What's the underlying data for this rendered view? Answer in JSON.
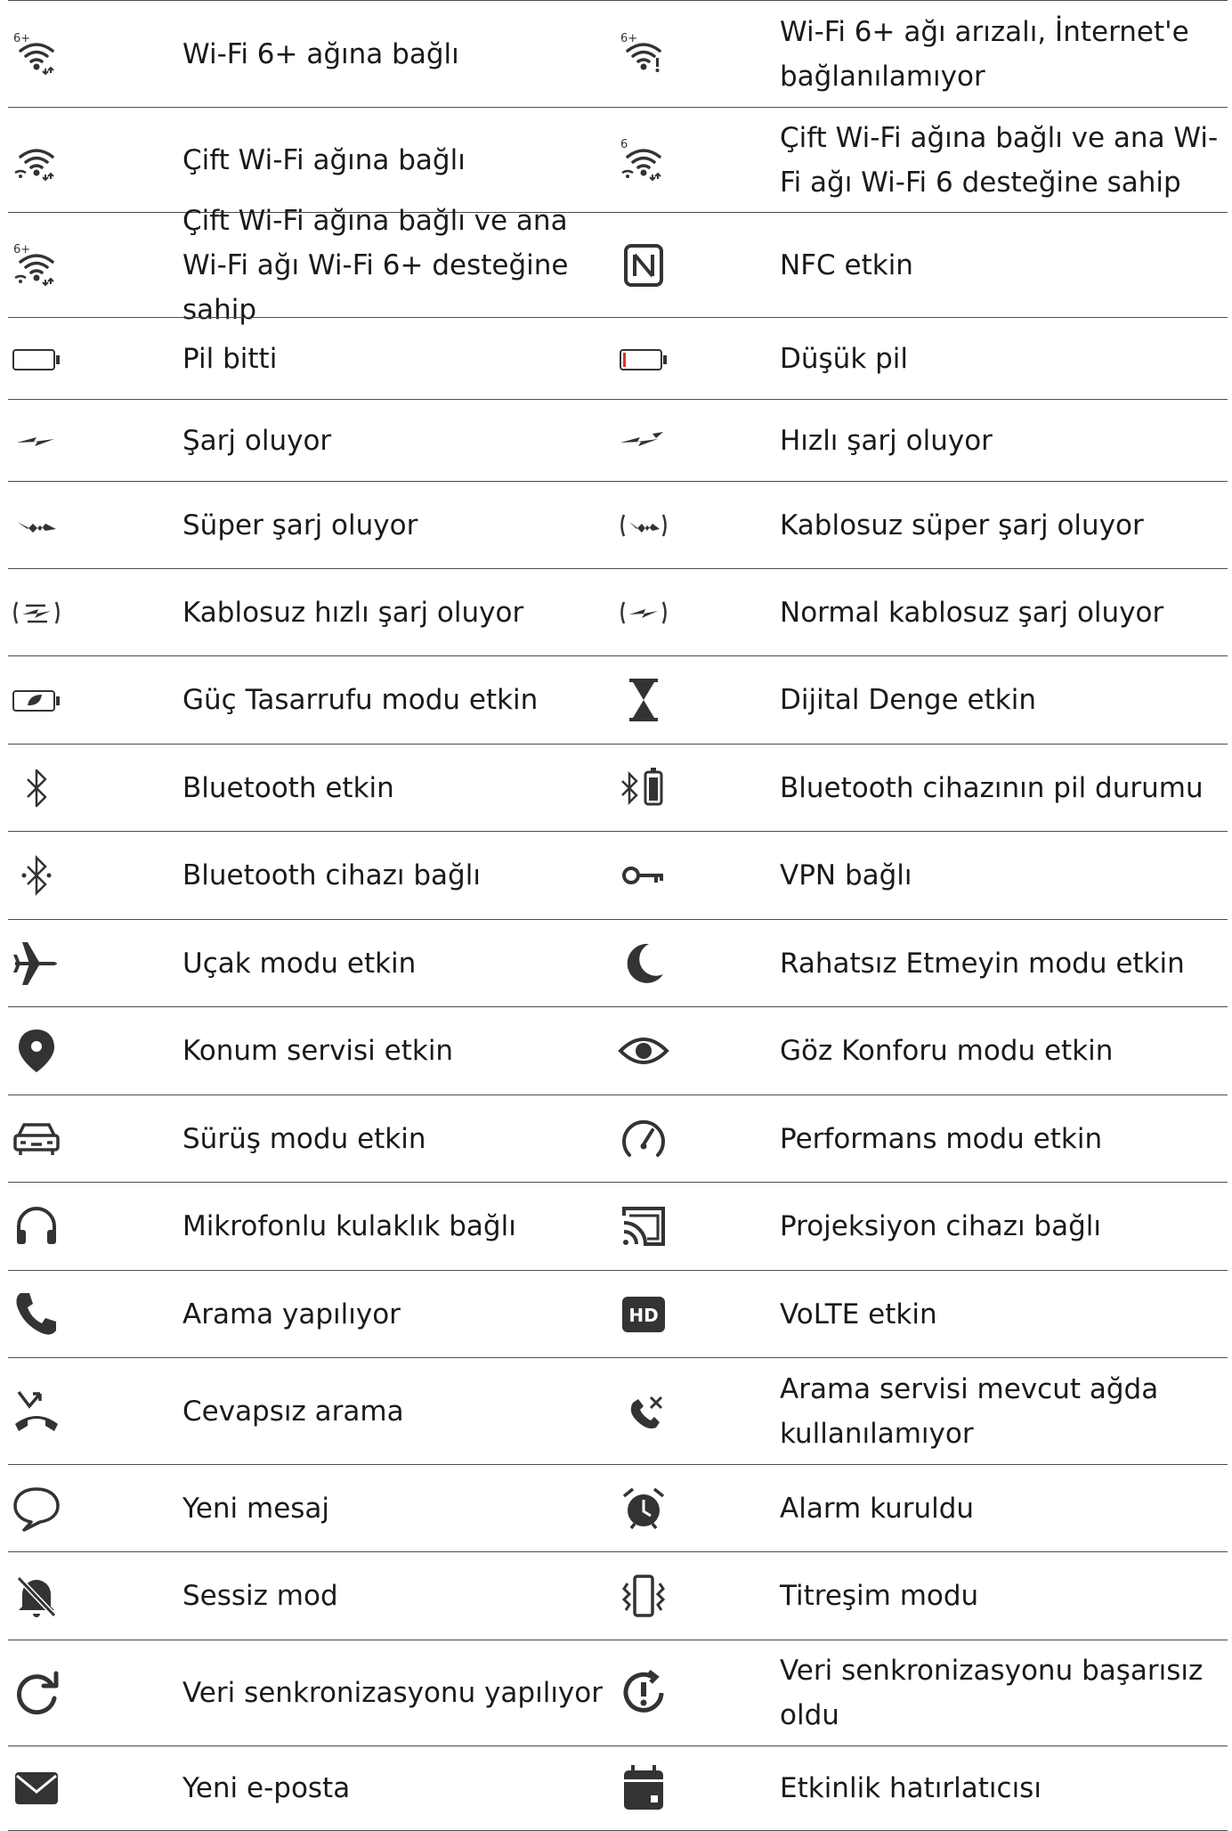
{
  "colors": {
    "icon": "#333333",
    "divider": "#4d4d4d",
    "low_battery": "#e03030"
  },
  "rows": [
    {
      "left": {
        "icon": "wifi6plus-icon",
        "text": "Wi-Fi 6+ ağına bağlı"
      },
      "right": {
        "icon": "wifi6plus-error-icon",
        "text": "Wi-Fi 6+ ağı arızalı, İnternet'e bağlanılamıyor"
      }
    },
    {
      "left": {
        "icon": "dual-wifi-icon",
        "text": "Çift Wi-Fi ağına bağlı"
      },
      "right": {
        "icon": "dual-wifi6-icon",
        "text": "Çift Wi-Fi ağına bağlı ve ana Wi-Fi ağı Wi-Fi 6 desteğine sahip"
      }
    },
    {
      "left": {
        "icon": "dual-wifi6plus-icon",
        "text": "Çift Wi-Fi ağına bağlı ve ana Wi-Fi ağı Wi-Fi 6+ desteğine sahip"
      },
      "right": {
        "icon": "nfc-icon",
        "text": "NFC etkin"
      }
    },
    {
      "left": {
        "icon": "battery-empty-icon",
        "text": "Pil bitti"
      },
      "right": {
        "icon": "battery-low-icon",
        "text": "Düşük pil"
      }
    },
    {
      "left": {
        "icon": "charging-icon",
        "text": "Şarj oluyor"
      },
      "right": {
        "icon": "fast-charging-icon",
        "text": "Hızlı şarj oluyor"
      }
    },
    {
      "left": {
        "icon": "super-charging-icon",
        "text": "Süper şarj oluyor"
      },
      "right": {
        "icon": "wireless-super-charging-icon",
        "text": "Kablosuz süper şarj oluyor"
      }
    },
    {
      "left": {
        "icon": "wireless-fast-charging-icon",
        "text": "Kablosuz hızlı şarj oluyor"
      },
      "right": {
        "icon": "wireless-charging-icon",
        "text": "Normal kablosuz şarj oluyor"
      }
    },
    {
      "left": {
        "icon": "power-saving-icon",
        "text": "Güç Tasarrufu modu etkin"
      },
      "right": {
        "icon": "hourglass-icon",
        "text": "Dijital Denge etkin"
      }
    },
    {
      "left": {
        "icon": "bluetooth-icon",
        "text": "Bluetooth etkin"
      },
      "right": {
        "icon": "bluetooth-battery-icon",
        "text": "Bluetooth cihazının pil durumu"
      }
    },
    {
      "left": {
        "icon": "bluetooth-connected-icon",
        "text": "Bluetooth cihazı bağlı"
      },
      "right": {
        "icon": "vpn-key-icon",
        "text": "VPN bağlı"
      }
    },
    {
      "left": {
        "icon": "airplane-icon",
        "text": "Uçak modu etkin"
      },
      "right": {
        "icon": "moon-icon",
        "text": "Rahatsız Etmeyin modu etkin"
      }
    },
    {
      "left": {
        "icon": "location-pin-icon",
        "text": "Konum servisi etkin"
      },
      "right": {
        "icon": "eye-icon",
        "text": "Göz Konforu modu etkin"
      }
    },
    {
      "left": {
        "icon": "car-icon",
        "text": "Sürüş modu etkin"
      },
      "right": {
        "icon": "speedometer-icon",
        "text": "Performans modu etkin"
      }
    },
    {
      "left": {
        "icon": "headset-icon",
        "text": "Mikrofonlu kulaklık bağlı"
      },
      "right": {
        "icon": "cast-icon",
        "text": "Projeksiyon cihazı bağlı"
      }
    },
    {
      "left": {
        "icon": "phone-call-icon",
        "text": "Arama yapılıyor"
      },
      "right": {
        "icon": "hd-icon",
        "text": "VoLTE etkin"
      }
    },
    {
      "left": {
        "icon": "missed-call-icon",
        "text": "Cevapsız arama"
      },
      "right": {
        "icon": "call-unavailable-icon",
        "text": "Arama servisi mevcut ağda kullanılamıyor"
      }
    },
    {
      "left": {
        "icon": "message-bubble-icon",
        "text": "Yeni mesaj"
      },
      "right": {
        "icon": "alarm-clock-icon",
        "text": "Alarm kuruldu"
      }
    },
    {
      "left": {
        "icon": "bell-muted-icon",
        "text": "Sessiz mod"
      },
      "right": {
        "icon": "vibrate-icon",
        "text": "Titreşim modu"
      }
    },
    {
      "left": {
        "icon": "sync-icon",
        "text": "Veri senkronizasyonu yapılıyor"
      },
      "right": {
        "icon": "sync-failed-icon",
        "text": "Veri senkronizasyonu başarısız oldu"
      }
    },
    {
      "left": {
        "icon": "email-envelope-icon",
        "text": "Yeni e-posta"
      },
      "right": {
        "icon": "calendar-icon",
        "text": "Etkinlik hatırlatıcısı"
      }
    }
  ]
}
